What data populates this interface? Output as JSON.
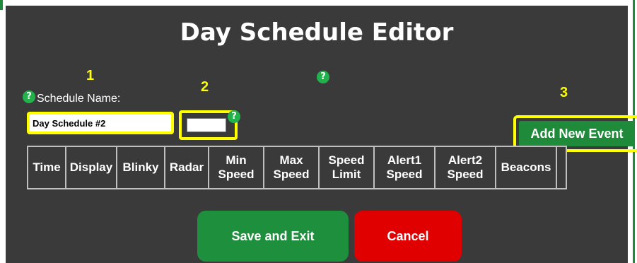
{
  "title": "Day Schedule Editor",
  "schedule": {
    "label": "Schedule Name:",
    "name_value": "Day Schedule #2"
  },
  "help_glyph": "?",
  "annotations": [
    "1",
    "2",
    "3"
  ],
  "buttons": {
    "add_event": "Add New Event",
    "save": "Save and Exit",
    "cancel": "Cancel"
  },
  "table": {
    "headers": [
      "Time",
      "Display",
      "Blinky",
      "Radar",
      "Min\nSpeed",
      "Max\nSpeed",
      "Speed\nLimit",
      "Alert1\nSpeed",
      "Alert2\nSpeed",
      "Beacons"
    ]
  },
  "colors": {
    "panel": "#3a3a3a",
    "accent_green": "#1e8a3a",
    "highlight_yellow": "#ffff00",
    "cancel_red": "#e00000"
  }
}
